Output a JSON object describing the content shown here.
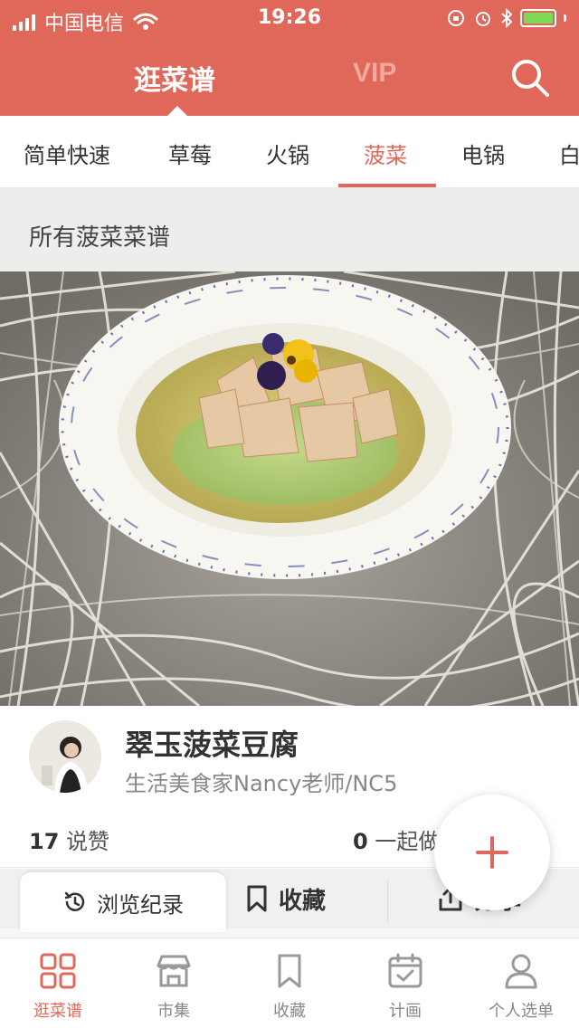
{
  "status_bar": {
    "carrier": "中国电信",
    "time": "19:26"
  },
  "header": {
    "tabs": [
      {
        "label": "逛菜谱",
        "active": true
      },
      {
        "label": "VIP",
        "active": false
      }
    ]
  },
  "categories": [
    "简单快速",
    "草莓",
    "火锅",
    "菠菜",
    "电锅",
    "白"
  ],
  "active_category": "菠菜",
  "section": {
    "title": "所有菠菜菜谱"
  },
  "recipe": {
    "title": "翠玉菠菜豆腐",
    "author": "生活美食家Nancy老师/NC5",
    "likes_count": "17",
    "likes_label": "说赞",
    "together_count": "0",
    "together_label": "一起做"
  },
  "actions": {
    "history": "浏览纪录",
    "favorite": "收藏",
    "share": "分享"
  },
  "tab_bar": [
    {
      "label": "逛菜谱",
      "icon": "grid-icon",
      "active": true
    },
    {
      "label": "市集",
      "icon": "store-icon",
      "active": false
    },
    {
      "label": "收藏",
      "icon": "bookmark-icon",
      "active": false
    },
    {
      "label": "计画",
      "icon": "calendar-check-icon",
      "active": false
    },
    {
      "label": "个人选单",
      "icon": "person-icon",
      "active": false
    }
  ],
  "colors": {
    "brand": "#e0685a",
    "header_inactive": "#f2a89f",
    "battery": "#7ed957"
  }
}
